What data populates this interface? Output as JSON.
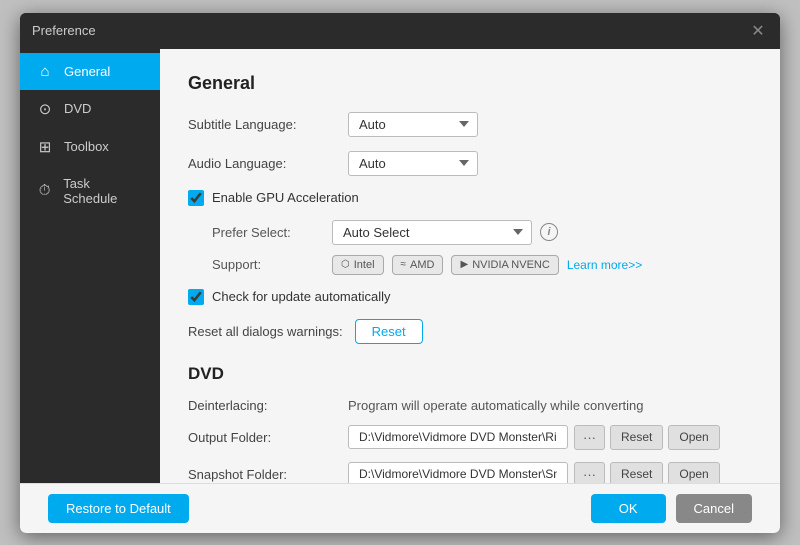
{
  "window": {
    "title": "Preference",
    "close_label": "✕"
  },
  "sidebar": {
    "items": [
      {
        "id": "general",
        "label": "General",
        "icon": "⌂",
        "active": true
      },
      {
        "id": "dvd",
        "label": "DVD",
        "icon": "⊙"
      },
      {
        "id": "toolbox",
        "label": "Toolbox",
        "icon": "⊞"
      },
      {
        "id": "task-schedule",
        "label": "Task Schedule",
        "icon": "⏱"
      }
    ]
  },
  "general": {
    "section_title": "General",
    "subtitle_language_label": "Subtitle Language:",
    "subtitle_language_value": "Auto",
    "audio_language_label": "Audio Language:",
    "audio_language_value": "Auto",
    "enable_gpu_label": "Enable GPU Acceleration",
    "prefer_select_label": "Prefer Select:",
    "prefer_select_value": "Auto Select",
    "support_label": "Support:",
    "badge_intel": "Intel",
    "badge_amd": "AMD",
    "badge_nvidia": "NVIDIA NVENC",
    "learn_more": "Learn more>>",
    "check_update_label": "Check for update automatically",
    "reset_dialogs_label": "Reset all dialogs warnings:",
    "reset_dialogs_btn": "Reset"
  },
  "dvd": {
    "section_title": "DVD",
    "deinterlacing_label": "Deinterlacing:",
    "deinterlacing_value": "Program will operate automatically while converting",
    "output_folder_label": "Output Folder:",
    "output_folder_value": "D:\\Vidmore\\Vidmore DVD Monster\\Riper",
    "snapshot_folder_label": "Snapshot Folder:",
    "snapshot_folder_value": "D:\\Vidmore\\Vidmore DVD Monster\\Snapshot",
    "dots_btn": "···",
    "reset_btn": "Reset",
    "open_btn": "Open"
  },
  "footer": {
    "restore_btn": "Restore to Default",
    "ok_btn": "OK",
    "cancel_btn": "Cancel"
  },
  "colors": {
    "accent": "#00aaee",
    "sidebar_bg": "#2b2b2b",
    "main_bg": "#f5f5f5"
  }
}
